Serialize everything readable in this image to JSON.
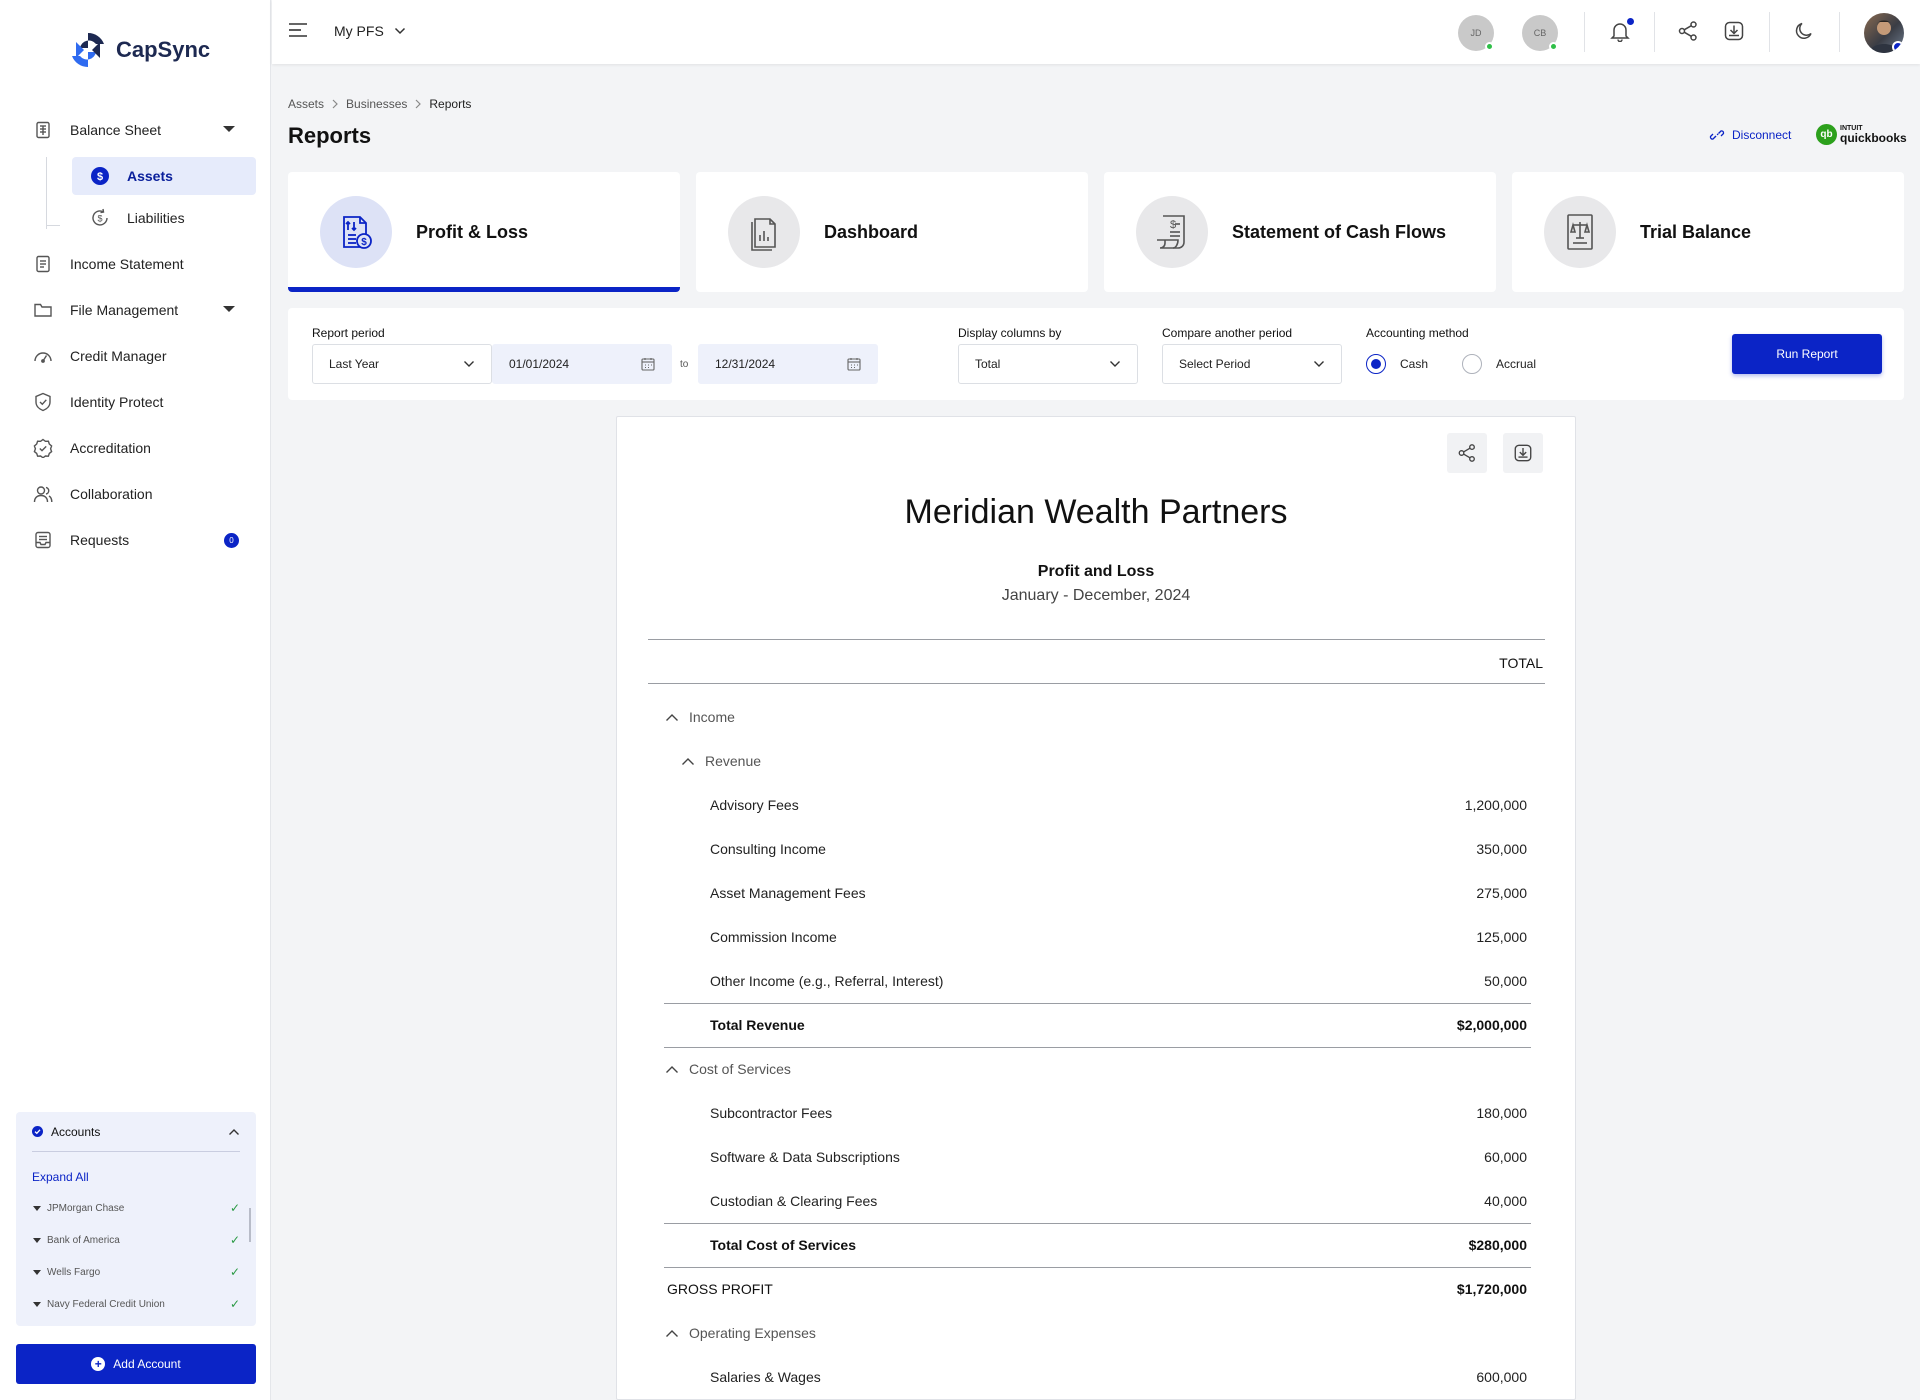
{
  "brand": {
    "name": "CapSync",
    "accent": "#0b24c6"
  },
  "sidebar": {
    "items": [
      {
        "label": "Balance Sheet",
        "icon": "balance-sheet-icon"
      },
      {
        "label": "Income Statement",
        "icon": "document-icon"
      },
      {
        "label": "File Management",
        "icon": "folder-icon"
      },
      {
        "label": "Credit Manager",
        "icon": "gauge-icon"
      },
      {
        "label": "Identity Protect",
        "icon": "shield-icon"
      },
      {
        "label": "Accreditation",
        "icon": "badge-check-icon"
      },
      {
        "label": "Collaboration",
        "icon": "users-icon"
      },
      {
        "label": "Requests",
        "icon": "inbox-icon",
        "badge": "0"
      }
    ],
    "sub_items": [
      {
        "label": "Assets",
        "icon": "dollar-coin-icon",
        "active": true
      },
      {
        "label": "Liabilities",
        "icon": "refresh-dollar-icon",
        "active": false
      }
    ],
    "accounts": {
      "title": "Accounts",
      "expand_all": "Expand All",
      "list": [
        "JPMorgan Chase",
        "Bank of America",
        "Wells Fargo",
        "Navy Federal Credit Union"
      ]
    },
    "add_account": "Add Account"
  },
  "header": {
    "workspace": "My PFS",
    "avatars": [
      "JD",
      "CB"
    ]
  },
  "breadcrumb": [
    "Assets",
    "Businesses",
    "Reports"
  ],
  "page_title": "Reports",
  "integration": {
    "disconnect": "Disconnect",
    "brand_small": "INTUIT",
    "brand_large": "quickbooks",
    "brand_mark": "qb"
  },
  "report_tabs": [
    {
      "label": "Profit & Loss",
      "icon": "profit-loss-icon",
      "active": true
    },
    {
      "label": "Dashboard",
      "icon": "dashboard-report-icon",
      "active": false
    },
    {
      "label": "Statement of Cash Flows",
      "icon": "cash-flow-icon",
      "active": false
    },
    {
      "label": "Trial Balance",
      "icon": "scale-icon",
      "active": false
    }
  ],
  "filters": {
    "report_period_label": "Report period",
    "report_period_value": "Last Year",
    "from_date": "01/01/2024",
    "to_label": "to",
    "to_date": "12/31/2024",
    "display_columns_label": "Display columns by",
    "display_columns_value": "Total",
    "compare_label": "Compare another period",
    "compare_value": "Select Period",
    "method_label": "Accounting method",
    "method_options": [
      {
        "label": "Cash",
        "selected": true
      },
      {
        "label": "Accrual",
        "selected": false
      }
    ],
    "run_report": "Run Report"
  },
  "report": {
    "company": "Meridian Wealth Partners",
    "title": "Profit and Loss",
    "period": "January - December, 2024",
    "column_header": "TOTAL",
    "rows": [
      {
        "label": "Income",
        "amount": "",
        "type": "group",
        "indent": 1
      },
      {
        "label": "Revenue",
        "amount": "",
        "type": "group",
        "indent": 2
      },
      {
        "label": "Advisory Fees",
        "amount": "1,200,000",
        "type": "line",
        "indent": 3
      },
      {
        "label": "Consulting Income",
        "amount": "350,000",
        "type": "line",
        "indent": 3
      },
      {
        "label": "Asset Management Fees",
        "amount": "275,000",
        "type": "line",
        "indent": 3
      },
      {
        "label": "Commission Income",
        "amount": "125,000",
        "type": "line",
        "indent": 3
      },
      {
        "label": "Other Income (e.g., Referral, Interest)",
        "amount": "50,000",
        "type": "line",
        "indent": 3
      },
      {
        "label": "Total Revenue",
        "amount": "$2,000,000",
        "type": "total",
        "indent": 3
      },
      {
        "label": "Cost of Services",
        "amount": "",
        "type": "group",
        "indent": 1,
        "topline": true
      },
      {
        "label": "Subcontractor Fees",
        "amount": "180,000",
        "type": "line",
        "indent": 3
      },
      {
        "label": "Software & Data Subscriptions",
        "amount": "60,000",
        "type": "line",
        "indent": 3
      },
      {
        "label": "Custodian & Clearing Fees",
        "amount": "40,000",
        "type": "line",
        "indent": 3
      },
      {
        "label": "Total Cost of Services",
        "amount": "$280,000",
        "type": "total",
        "indent": 3
      },
      {
        "label": "GROSS PROFIT",
        "amount": "$1,720,000",
        "type": "gross",
        "indent": 0,
        "topline": true
      },
      {
        "label": "Operating Expenses",
        "amount": "",
        "type": "group",
        "indent": 1
      },
      {
        "label": "Salaries & Wages",
        "amount": "600,000",
        "type": "line",
        "indent": 3
      }
    ]
  }
}
